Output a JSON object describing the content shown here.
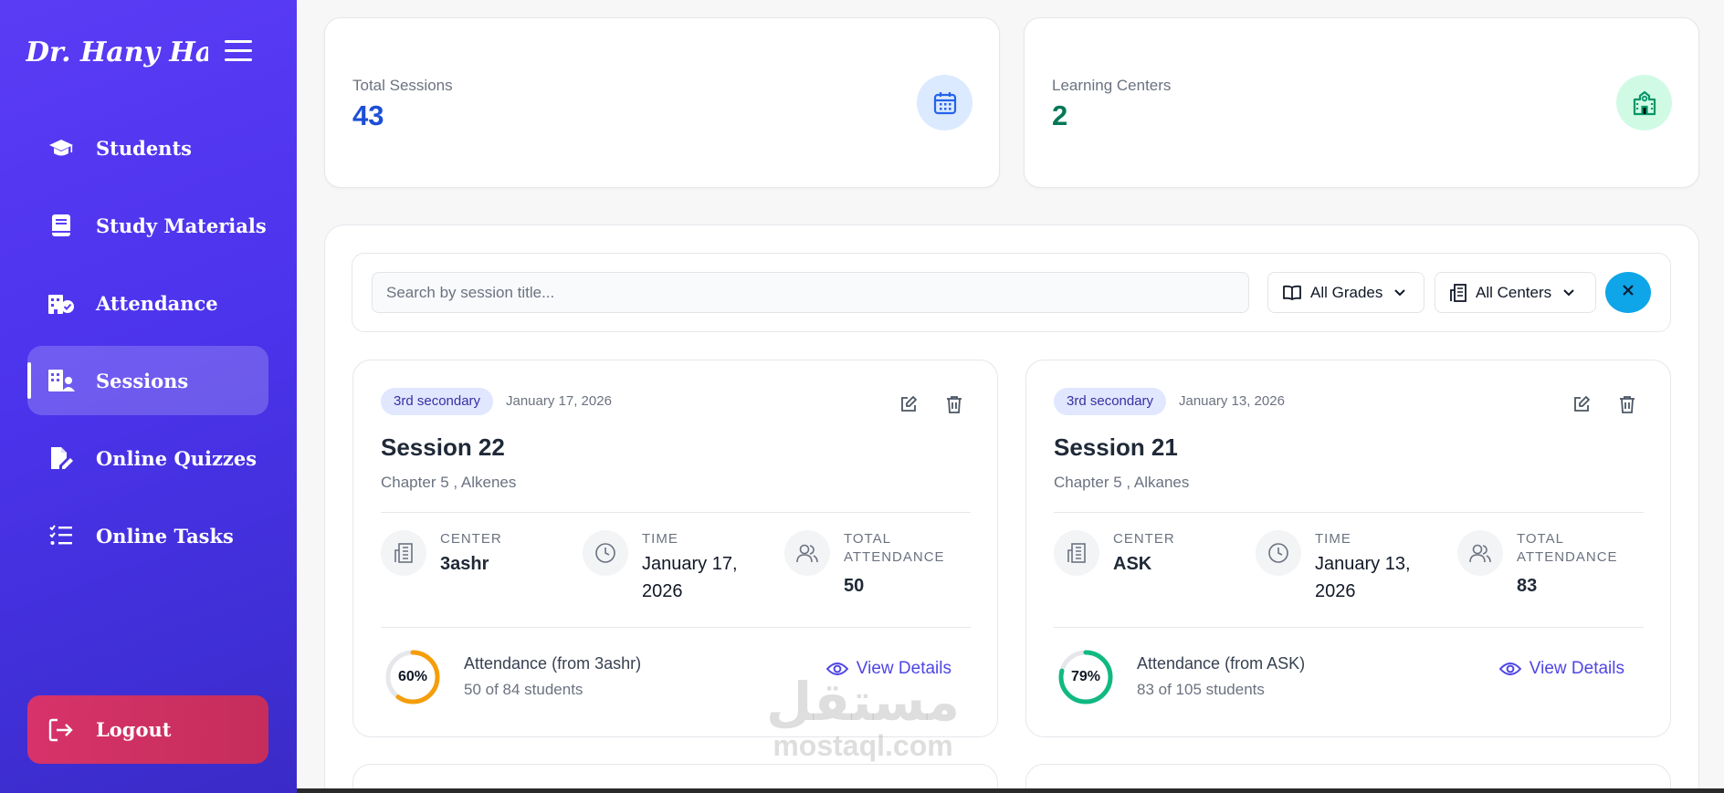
{
  "sidebar": {
    "brand": "Dr. Hany Hassan",
    "items": [
      {
        "label": "Students",
        "icon": "graduation-cap-icon"
      },
      {
        "label": "Study Materials",
        "icon": "book-icon"
      },
      {
        "label": "Attendance",
        "icon": "building-check-icon"
      },
      {
        "label": "Sessions",
        "icon": "building-user-icon",
        "active": true
      },
      {
        "label": "Online Quizzes",
        "icon": "file-pen-icon"
      },
      {
        "label": "Online Tasks",
        "icon": "list-check-icon"
      }
    ],
    "logout_label": "Logout"
  },
  "stats": [
    {
      "label": "Total Sessions",
      "value": "43",
      "color": "#1d4ed8",
      "icon": "calendar-icon"
    },
    {
      "label": "Learning Centers",
      "value": "2",
      "color": "#047857",
      "icon": "school-icon"
    }
  ],
  "filters": {
    "search_placeholder": "Search by session title...",
    "grades_label": "All Grades",
    "centers_label": "All Centers"
  },
  "sessions": [
    {
      "grade": "3rd secondary",
      "date": "January 17, 2026",
      "title": "Session 22",
      "subtitle": "Chapter 5 , Alkenes",
      "center_label": "CENTER",
      "center": "3ashr",
      "time_label": "TIME",
      "time": "January 17, 2026",
      "total_label": "TOTAL ATTENDANCE",
      "total": "50",
      "percent": 60,
      "percent_text": "60%",
      "ring_color": "#f59e0b",
      "attendance_title": "Attendance (from 3ashr)",
      "attendance_sub": "50 of 84 students",
      "view_label": "View Details"
    },
    {
      "grade": "3rd secondary",
      "date": "January 13, 2026",
      "title": "Session 21",
      "subtitle": "Chapter 5 , Alkanes",
      "center_label": "CENTER",
      "center": "ASK",
      "time_label": "TIME",
      "time": "January 13, 2026",
      "total_label": "TOTAL ATTENDANCE",
      "total": "83",
      "percent": 79,
      "percent_text": "79%",
      "ring_color": "#10b981",
      "attendance_title": "Attendance (from ASK)",
      "attendance_sub": "83 of 105 students",
      "view_label": "View Details"
    }
  ],
  "watermark": {
    "arabic": "مستقل",
    "latin": "mostaql.com"
  }
}
